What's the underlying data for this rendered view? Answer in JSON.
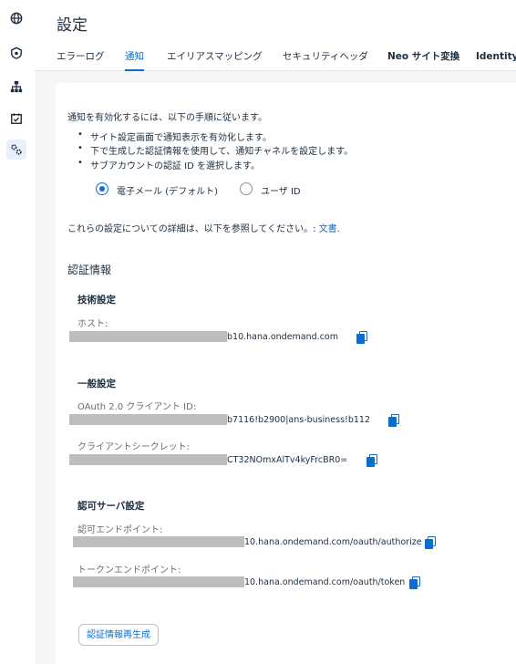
{
  "page": {
    "title": "設定"
  },
  "tabs": [
    {
      "label": "エラーログ",
      "active": false
    },
    {
      "label": "通知",
      "active": true
    },
    {
      "label": "エイリアスマッピング",
      "active": false
    },
    {
      "label": "セキュリティヘッダ",
      "active": false
    },
    {
      "label": "Neo サイト変換",
      "active": false
    },
    {
      "label": "Identity P",
      "active": false
    }
  ],
  "sidebar": {
    "icons": [
      "globe-icon",
      "shield-icon",
      "org-chart-icon",
      "tasks-icon",
      "settings-icon"
    ],
    "active_index": 4
  },
  "intro": {
    "text": "通知を有効化するには、以下の手順に従います。",
    "steps": [
      "サイト設定画面で通知表示を有効化します。",
      "下で生成した認証情報を使用して、通知チャネルを設定します。",
      "サブアカウントの認証 ID を選択します。"
    ]
  },
  "auth_options": {
    "email_label": "電子メール (デフォルト)",
    "user_id_label": "ユーザ ID",
    "selected": "email"
  },
  "more_info": {
    "text": "これらの設定についての詳細は、以下を参照してください。: ",
    "link": "文書",
    "suffix": "."
  },
  "credentials": {
    "title": "認証情報",
    "technical": {
      "title": "技術設定",
      "host_label": "ホスト:",
      "host_value": "b10.hana.ondemand.com"
    },
    "general": {
      "title": "一般設定",
      "client_id_label": "OAuth 2.0 クライアント ID:",
      "client_id_value": "b7116!b2900|ans-business!b112",
      "secret_label": "クライアントシークレット:",
      "secret_value": "CT32NOmxAlTv4kyFrcBR0="
    },
    "auth_server": {
      "title": "認可サーバ設定",
      "auth_endpoint_label": "認可エンドポイント:",
      "auth_endpoint_value": "10.hana.ondemand.com/oauth/authorize",
      "token_endpoint_label": "トークンエンドポイント:",
      "token_endpoint_value": "10.hana.ondemand.com/oauth/token"
    }
  },
  "regenerate_button": "認証情報再生成",
  "colors": {
    "accent": "#0a6ed1",
    "redaction": "#bdbdbd",
    "background": "#f5f6f7"
  }
}
